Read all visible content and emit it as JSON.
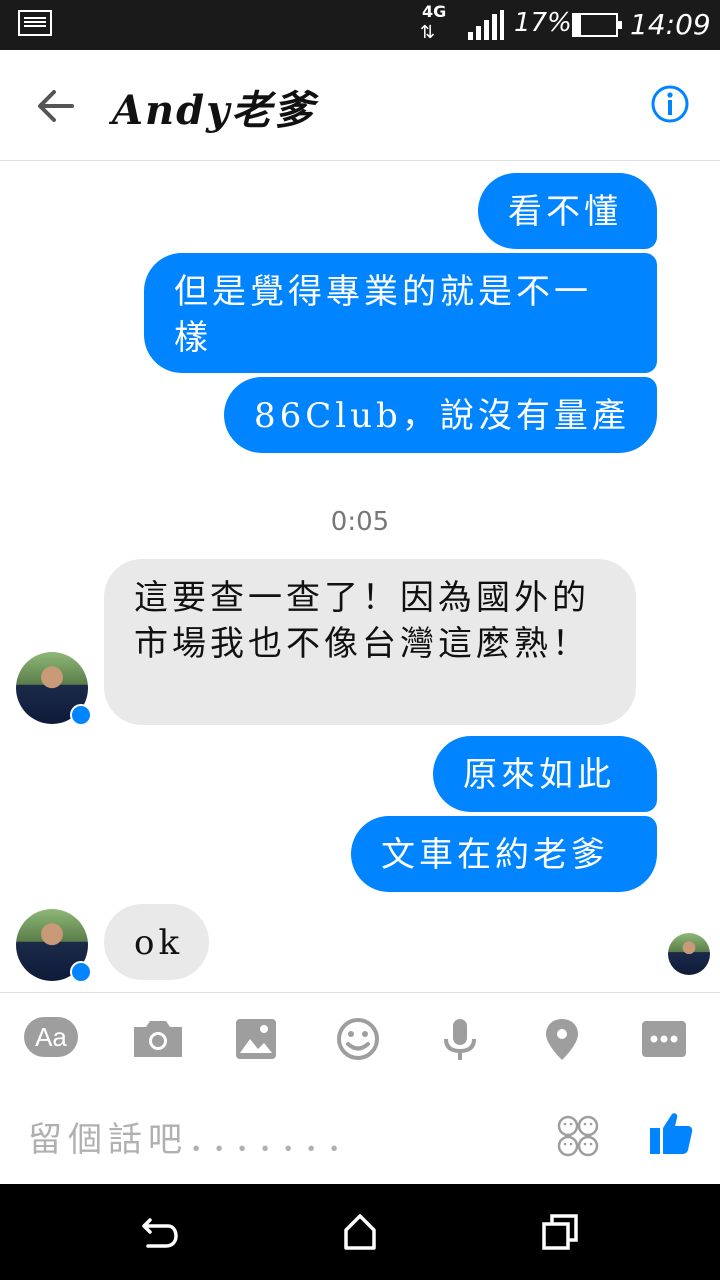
{
  "status_bar": {
    "network": "4G",
    "battery": "17%",
    "battery_level": 0.17,
    "time": "14:09"
  },
  "header": {
    "title": "Andy老爹",
    "back_icon": "arrow-left-icon",
    "info_icon": "info-icon"
  },
  "messages": [
    {
      "sender": "me",
      "text": "看不懂"
    },
    {
      "sender": "me",
      "text": "但是覺得專業的就是不一樣"
    },
    {
      "sender": "me",
      "text": "86Club，說沒有量產"
    },
    {
      "type": "timestamp",
      "text": "0:05"
    },
    {
      "sender": "contact",
      "text": "這要查一查了！因為國外的市場我也不像台灣這麼熟！"
    },
    {
      "sender": "me",
      "text": "原來如此"
    },
    {
      "sender": "me",
      "text": "文車在約老爹"
    },
    {
      "sender": "contact",
      "text": "ok"
    }
  ],
  "toolbar": {
    "text_label": "Aa",
    "icons": [
      "text-format-icon",
      "camera-icon",
      "image-icon",
      "emoji-icon",
      "microphone-icon",
      "location-icon",
      "more-icon"
    ]
  },
  "composer": {
    "placeholder": "留個話吧．．．．．．．",
    "sticker_icon": "sticker-icon",
    "like_icon": "thumbs-up-icon"
  },
  "colors": {
    "accent": "#0084ff",
    "incoming_bubble": "#e9e9e9"
  }
}
